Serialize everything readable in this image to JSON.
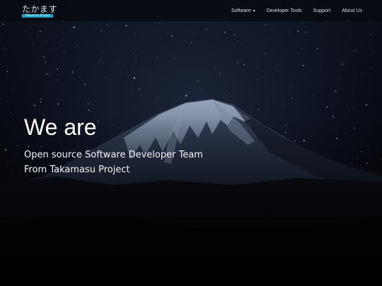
{
  "brand": {
    "logo_text": "たかます",
    "logo_subtext": "Takamasu Project",
    "accent_color": "#1e9cc2"
  },
  "nav": {
    "items": [
      {
        "label": "Software",
        "dropdown": true,
        "caret": "▾"
      },
      {
        "label": "Developer Tools",
        "dropdown": false
      },
      {
        "label": "Support",
        "dropdown": false
      },
      {
        "label": "About Us",
        "dropdown": false
      }
    ]
  },
  "hero": {
    "title": "We are",
    "lines": [
      "Open source Software Developer Team",
      "From Takamasu Project"
    ],
    "background": "night-sky-mountain-image"
  }
}
